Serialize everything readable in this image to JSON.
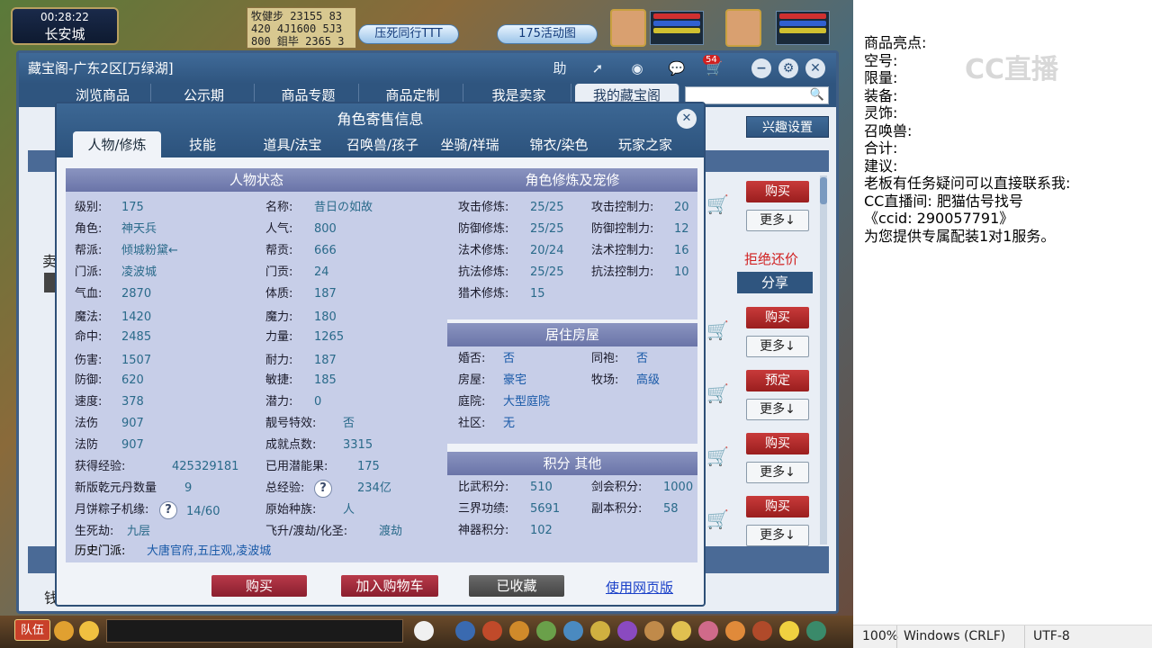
{
  "game_hud": {
    "time": "00:28:22",
    "city": "长安城",
    "coords": [
      "牧健步 23155 83",
      "420 4J1600 5J3",
      "800 鉬毕 2365 3"
    ],
    "event_btn": "压死同行TTT",
    "activity_btn": "175活动图"
  },
  "window": {
    "title": "藏宝阁-广东2区[万绿湖]",
    "help": "助",
    "message_count": "54",
    "nav": [
      "浏览商品",
      "公示期",
      "商品专题",
      "商品定制",
      "我是卖家",
      "我的藏宝阁"
    ],
    "interest_btn": "兴趣设置",
    "list_buttons": [
      {
        "action": "购买",
        "more": "更多↓"
      },
      {
        "action": "购买",
        "more": "更多↓"
      },
      {
        "action": "预定",
        "more": "更多↓"
      },
      {
        "action": "购买",
        "more": "更多↓"
      },
      {
        "action": "购买",
        "more": "更多↓"
      }
    ],
    "reject_bargain": "拒绝还价",
    "share": "分享",
    "sell_frag": "卖",
    "money_frag": "钱"
  },
  "dialog": {
    "title": "角色寄售信息",
    "close": "✕",
    "tabs": [
      "人物/修炼",
      "技能",
      "道具/法宝",
      "召唤兽/孩子",
      "坐骑/祥瑞",
      "锦衣/染色",
      "玩家之家"
    ],
    "status_header": "人物状态",
    "left_col": [
      {
        "label": "级别:",
        "value": "175"
      },
      {
        "label": "角色:",
        "value": "神天兵"
      },
      {
        "label": "帮派:",
        "value": "倾城粉黛←"
      },
      {
        "label": "门派:",
        "value": "凌波城"
      },
      {
        "label": "气血:",
        "value": "2870"
      },
      {
        "label": "魔法:",
        "value": "1420"
      },
      {
        "label": "命中:",
        "value": "2485"
      },
      {
        "label": "伤害:",
        "value": "1507"
      },
      {
        "label": "防御:",
        "value": "620"
      },
      {
        "label": "速度:",
        "value": "378"
      },
      {
        "label": "法伤",
        "value": "907"
      },
      {
        "label": "法防",
        "value": "907"
      },
      {
        "label": "获得经验:",
        "value": "425329181"
      },
      {
        "label": "新版乾元丹数量",
        "value": "9"
      },
      {
        "label": "月饼粽子机缘:",
        "value": "14/60"
      },
      {
        "label": "生死劫:",
        "value": "九层"
      }
    ],
    "right_col": [
      {
        "label": "名称:",
        "value": "昔日の如故"
      },
      {
        "label": "人气:",
        "value": "800"
      },
      {
        "label": "帮贡:",
        "value": "666"
      },
      {
        "label": "门贡:",
        "value": "24"
      },
      {
        "label": "体质:",
        "value": "187"
      },
      {
        "label": "魔力:",
        "value": "180"
      },
      {
        "label": "力量:",
        "value": "1265"
      },
      {
        "label": "耐力:",
        "value": "187"
      },
      {
        "label": "敏捷:",
        "value": "185"
      },
      {
        "label": "潜力:",
        "value": "0"
      },
      {
        "label": "靓号特效:",
        "value": "否"
      },
      {
        "label": "成就点数:",
        "value": "3315"
      },
      {
        "label": "已用潜能果:",
        "value": "175"
      },
      {
        "label": "总经验:",
        "value": "234亿"
      },
      {
        "label": "原始种族:",
        "value": "人"
      },
      {
        "label": "飞升/渡劫/化圣:",
        "value": "渡劫"
      }
    ],
    "history_label": "历史门派:",
    "history_value": "大唐官府,五庄观,凌波城",
    "question_mark": "?",
    "cultivation_header": "角色修炼及宠修",
    "cultivation": [
      {
        "label": "攻击修炼:",
        "value": "25/25",
        "label2": "攻击控制力:",
        "value2": "20"
      },
      {
        "label": "防御修炼:",
        "value": "25/25",
        "label2": "防御控制力:",
        "value2": "12"
      },
      {
        "label": "法术修炼:",
        "value": "20/24",
        "label2": "法术控制力:",
        "value2": "16"
      },
      {
        "label": "抗法修炼:",
        "value": "25/25",
        "label2": "抗法控制力:",
        "value2": "10"
      },
      {
        "label": "猎术修炼:",
        "value": "15"
      }
    ],
    "house_header": "居住房屋",
    "house": [
      {
        "label": "婚否:",
        "value": "否",
        "label2": "同袍:",
        "value2": "否"
      },
      {
        "label": "房屋:",
        "value": "豪宅",
        "label2": "牧场:",
        "value2": "高级"
      },
      {
        "label": "庭院:",
        "value": "大型庭院"
      },
      {
        "label": "社区:",
        "value": "无"
      }
    ],
    "points_header": "积分 其他",
    "points": [
      {
        "label": "比武积分:",
        "value": "510",
        "label2": "剑会积分:",
        "value2": "1000"
      },
      {
        "label": "三界功绩:",
        "value": "5691",
        "label2": "副本积分:",
        "value2": "58"
      },
      {
        "label": "神器积分:",
        "value": "102"
      }
    ],
    "buy_btn": "购买",
    "cart_btn": "加入购物车",
    "fav_btn": "已收藏",
    "web_link": "使用网页版"
  },
  "taskbar": {
    "team": "队伍"
  },
  "notepad": {
    "lines": [
      "商品亮点:",
      "",
      "空号:",
      "限量:",
      "装备:",
      "灵饰:",
      "召唤兽:",
      "合计:",
      "建议:",
      "老板有任务疑问可以直接联系我:",
      "CC直播间: 肥猫估号找号",
      "《ccid: 290057791》",
      "为您提供专属配装1对1服务。"
    ],
    "logo": "CC直播",
    "zoom": "100%",
    "line_ending": "Windows (CRLF)",
    "encoding": "UTF-8"
  },
  "colors": {
    "window_blue": "#2f557f",
    "panel_lavender": "#c7cee8",
    "buy_red": "#9a1e1e",
    "value_teal": "#2a6a8a"
  }
}
